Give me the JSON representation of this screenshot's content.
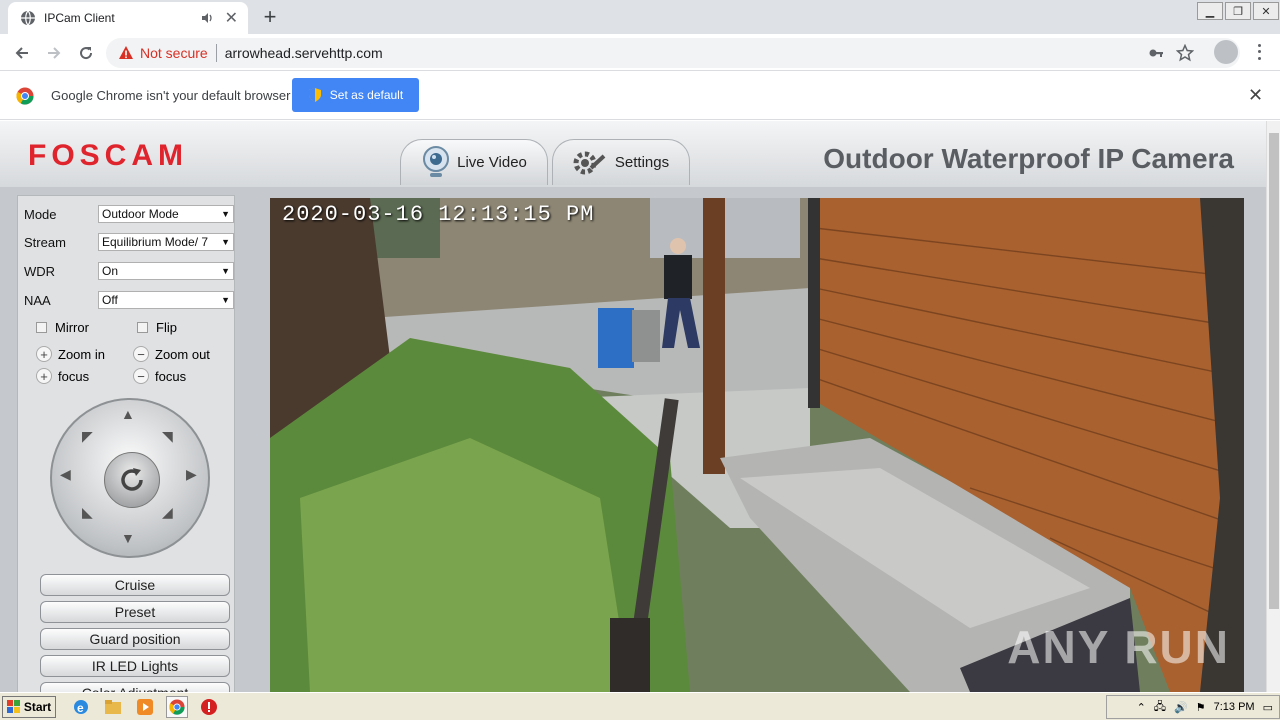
{
  "browser": {
    "tab_title": "IPCam Client",
    "new_tab": "+",
    "security_label": "Not secure",
    "url": "arrowhead.servehttp.com"
  },
  "infobar": {
    "message": "Google Chrome isn't your default browser",
    "button": "Set as default"
  },
  "page": {
    "logo": "FOSCAM",
    "tabs": {
      "live": "Live Video",
      "settings": "Settings"
    },
    "camera_title": "Outdoor Waterproof IP Camera",
    "controls": {
      "mode_label": "Mode",
      "mode_value": "Outdoor Mode",
      "stream_label": "Stream",
      "stream_value": "Equilibrium Mode/ 7",
      "wdr_label": "WDR",
      "wdr_value": "On",
      "naa_label": "NAA",
      "naa_value": "Off",
      "mirror": "Mirror",
      "flip": "Flip",
      "zoom_in": "Zoom in",
      "zoom_out": "Zoom out",
      "focus_plus": "focus",
      "focus_minus": "focus"
    },
    "buttons": [
      "Cruise",
      "Preset",
      "Guard position",
      "IR LED Lights",
      "Color Adjustment"
    ],
    "video": {
      "timestamp": "2020-03-16 12:13:15 PM",
      "watermark": "ANY RUN"
    }
  },
  "taskbar": {
    "start": "Start",
    "clock": "7:13 PM"
  }
}
